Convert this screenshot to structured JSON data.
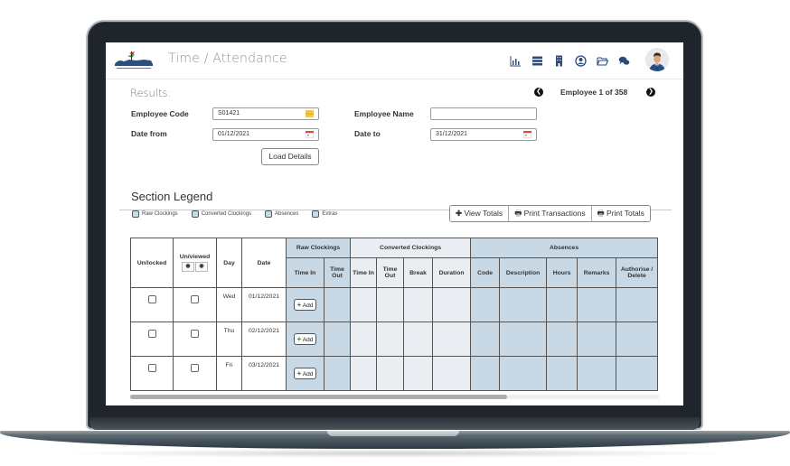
{
  "header": {
    "app_title": "Time / Attendance",
    "icons": [
      "bar-chart-icon",
      "server-list-icon",
      "building-icon",
      "user-circle-icon",
      "folder-open-icon",
      "chat-bubbles-icon"
    ],
    "avatar": "user-avatar"
  },
  "results": {
    "label": "Results:",
    "employee_counter": "Employee 1 of 358",
    "prev_icon": "chevron-left-circle-icon",
    "next_icon": "chevron-right-circle-icon"
  },
  "form": {
    "employee_code_label": "Employee Code",
    "employee_code_value": "S01421",
    "employee_name_label": "Employee Name",
    "employee_name_value": "",
    "date_from_label": "Date from",
    "date_from_value": "01/12/2021",
    "date_to_label": "Date to",
    "date_to_value": "31/12/2021",
    "load_button": "Load Details"
  },
  "legend": {
    "title": "Section Legend",
    "items": [
      {
        "label": "Raw Clockings",
        "color": "#c8d9e5"
      },
      {
        "label": "Converted Clockings",
        "color": "#c8d9e5"
      },
      {
        "label": "Absences",
        "color": "#c8d9e5"
      },
      {
        "label": "Extras",
        "color": "#c8d9e5"
      }
    ]
  },
  "actions": {
    "view_totals": "View Totals",
    "print_transactions": "Print Transactions",
    "print_totals": "Print Totals"
  },
  "table": {
    "group_headers": {
      "raw_clockings": "Raw Clockings",
      "converted_clockings": "Converted Clockings",
      "absences": "Absences"
    },
    "columns": {
      "unlocked": "Un/locked",
      "unviewed": "Un/viewed",
      "day": "Day",
      "date": "Date",
      "raw_time_in": "Time In",
      "raw_time_out": "Time Out",
      "conv_time_in": "Time In",
      "conv_time_out": "Time Out",
      "break": "Break",
      "duration": "Duration",
      "code": "Code",
      "description": "Description",
      "hours": "Hours",
      "remarks": "Remarks",
      "authorise": "Authorise / Delete"
    },
    "add_label": "Add",
    "rows": [
      {
        "day": "Wed",
        "date": "01/12/2021"
      },
      {
        "day": "Thu",
        "date": "02/12/2021"
      },
      {
        "day": "Fri",
        "date": "03/12/2021"
      }
    ]
  },
  "colors": {
    "raw_section": "#c8d9e5",
    "converted_section": "#eaeef2",
    "absences_section": "#c8d9e5",
    "add_plus": "#1c8a2b"
  }
}
